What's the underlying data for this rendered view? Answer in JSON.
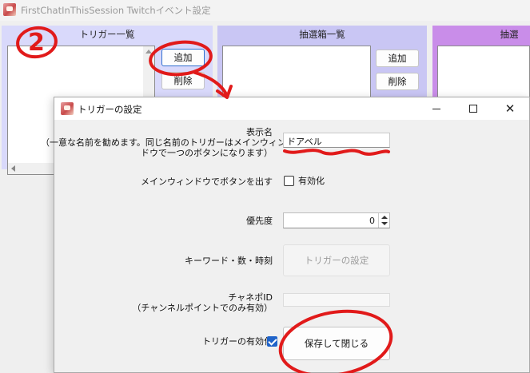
{
  "main_window": {
    "title": "FirstChatInThisSession Twitchイベント設定",
    "trigger_group": {
      "header": "トリガー一覧",
      "add_label": "追加",
      "delete_label": "削除"
    },
    "box_group": {
      "header": "抽選箱一覧",
      "add_label": "追加",
      "delete_label": "削除"
    },
    "third_group": {
      "header": "抽選"
    }
  },
  "dialog": {
    "title": "トリガーの設定",
    "display_name_label": "表示名",
    "display_name_note_1": "（一意な名前を勧めます。同じ名前のトリガーはメインウィン",
    "display_name_note_2": "ドウで一つのボタンになります）",
    "display_name_value": "ドアベル",
    "main_button_label": "メインウィンドウでボタンを出す",
    "enabled_checkbox_label": "有効化",
    "priority_label": "優先度",
    "priority_value": "0",
    "keyword_label": "キーワード・数・時刻",
    "trigger_settings_button": "トリガーの設定",
    "channel_point_label_1": "チャネポID",
    "channel_point_label_2": "（チャンネルポイントでのみ有効）",
    "trigger_enable_label": "トリガーの有効化",
    "save_close_button": "保存して閉じる"
  },
  "annotation": {
    "step_number": "2",
    "color": "#e11a1a"
  },
  "colors": {
    "trigger_group_bg": "#d9d9fb",
    "box_group_bg": "#c9c6f4",
    "third_group_bg": "#c98de9",
    "checkbox_checked": "#1f63c9"
  }
}
